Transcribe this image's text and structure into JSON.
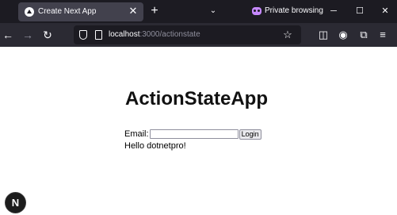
{
  "tab": {
    "title": "Create Next App",
    "close_glyph": "✕"
  },
  "tabbar": {
    "new_tab_glyph": "+",
    "tab_list_glyph": "⌄",
    "private_label": "Private browsing"
  },
  "window": {
    "minimize_glyph": "─",
    "maximize_glyph": "☐",
    "close_glyph": "✕"
  },
  "nav": {
    "back_glyph": "←",
    "forward_glyph": "→",
    "reload_glyph": "↻"
  },
  "urlbar": {
    "host": "localhost",
    "path": ":3000/actionstate",
    "star_glyph": "☆"
  },
  "toolbar": {
    "pocket_glyph": "◫",
    "account_glyph": "◉",
    "extensions_glyph": "⧉",
    "menu_glyph": "≡"
  },
  "page": {
    "heading": "ActionStateApp",
    "email_label": "Email:",
    "email_value": "",
    "login_label": "Login",
    "message": "Hello dotnetpro!"
  },
  "next_badge": {
    "letter": "N"
  },
  "colors": {
    "tabbar_bg": "#1c1b22",
    "navbar_bg": "#2b2a33",
    "active_tab_bg": "#42414d",
    "private_accent": "#c689ff"
  }
}
